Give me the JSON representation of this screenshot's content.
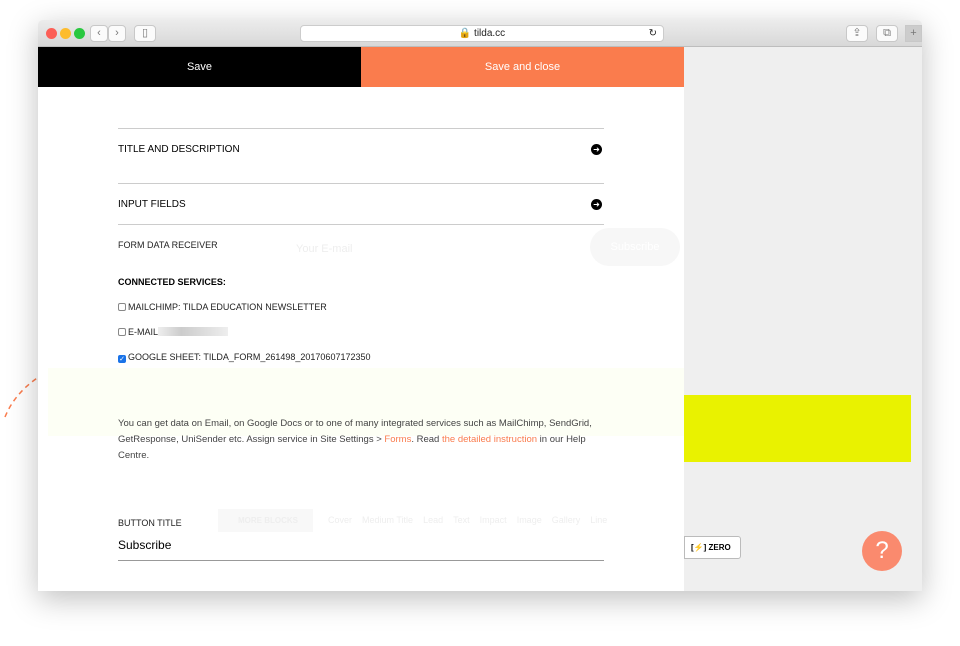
{
  "browser": {
    "url": "tilda.cc",
    "back": "‹",
    "forward": "›",
    "new_tab": "+"
  },
  "topbar": {
    "save": "Save",
    "save_close": "Save and close"
  },
  "sections": [
    {
      "label": "TITLE AND DESCRIPTION"
    },
    {
      "label": "INPUT FIELDS"
    }
  ],
  "receiver": {
    "label": "FORM DATA RECEIVER",
    "heading": "CONNECTED SERVICES:",
    "services": [
      {
        "label": "MAILCHIMP: TILDA EDUCATION NEWSLETTER",
        "checked": false
      },
      {
        "label": "E-MAIL",
        "checked": false
      },
      {
        "label": "GOOGLE SHEET: TILDA_FORM_261498_20170607172350",
        "checked": true
      }
    ]
  },
  "background": {
    "email_placeholder": "Your E-mail",
    "subscribe": "Subscribe",
    "more_blocks": "MORE BLOCKS",
    "block_tabs": [
      "Cover",
      "Medium Title",
      "Lead",
      "Text",
      "Impact",
      "Image",
      "Gallery",
      "Line"
    ],
    "zero": "ZERO"
  },
  "info": {
    "text1": "You can get data on Email, on Google Docs or to one of many integrated services such as MailChimp, SendGrid, GetResponse, UniSender etc. Assign service in Site Settings > ",
    "link1": "Forms",
    "text2": ". Read ",
    "link2": "the detailed instruction",
    "text3": " in our Help Centre."
  },
  "button_title": {
    "label": "BUTTON TITLE",
    "value": "Subscribe"
  },
  "help": {
    "label": "?"
  },
  "colors": {
    "accent": "#fa7c4d",
    "yellow": "#e9f200"
  }
}
